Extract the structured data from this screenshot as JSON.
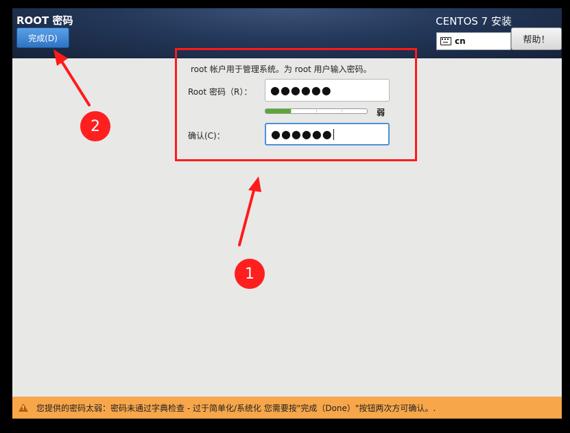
{
  "header": {
    "spoke_title": "ROOT 密码",
    "done_label": "完成(D)",
    "product_title": "CENTOS 7 安装",
    "keyboard_layout": "cn",
    "help_label": "帮助！"
  },
  "form": {
    "description": "root 帐户用于管理系统。为 root 用户输入密码。",
    "password_label": "Root 密码（R）：",
    "password_value": "●●●●●●",
    "strength_label": "弱",
    "strength_level": 0.25,
    "confirm_label": "确认(C)：",
    "confirm_value": "●●●●●●"
  },
  "annotations": {
    "marker_1": "1",
    "marker_2": "2"
  },
  "warning": {
    "message": "您提供的密码太弱：密码未通过字典检查 - 过于简单化/系统化 您需要按\"完成（Done）\"按钮两次方可确认。."
  },
  "colors": {
    "accent": "#4a90d9",
    "warning_bg": "#f7a64a",
    "annotation_red": "#ff1a1a",
    "strength_fill": "#5aa836"
  }
}
